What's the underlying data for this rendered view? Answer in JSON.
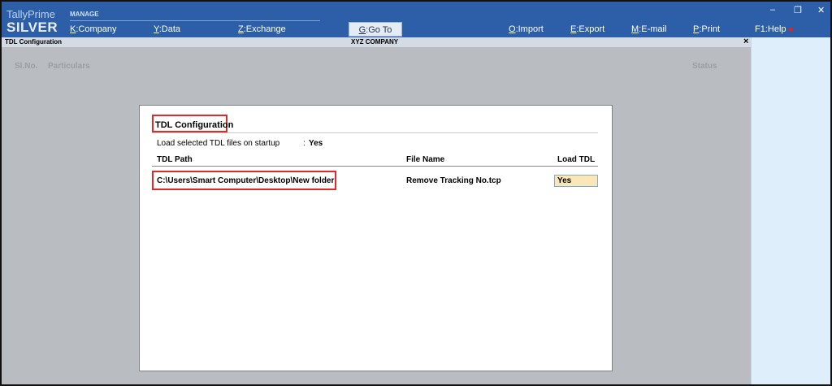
{
  "brand": {
    "line1": "TallyPrime",
    "line2": "SILVER"
  },
  "topbar": {
    "section_label": "MANAGE",
    "menu": [
      {
        "key": "K",
        "label": ":Company"
      },
      {
        "key": "Y",
        "label": ":Data"
      },
      {
        "key": "Z",
        "label": ":Exchange"
      }
    ],
    "goto": {
      "key": "G",
      "label": ":Go To"
    },
    "right_menu": [
      {
        "key": "O",
        "label": ":Import"
      },
      {
        "key": "E",
        "label": ":Export"
      },
      {
        "key": "M",
        "label": ":E-mail"
      },
      {
        "key": "P",
        "label": ":Print"
      },
      {
        "key": "F1",
        "label": ":Help"
      }
    ],
    "window_controls": {
      "minimize": "–",
      "restore": "❐",
      "close": "✕"
    }
  },
  "title_strip": {
    "screen_name": "TDL Configuration",
    "company": "XYZ COMPANY",
    "close": "×"
  },
  "background_table": {
    "headers": {
      "slno": "Sl.No.",
      "particulars": "Particulars",
      "status": "Status"
    }
  },
  "dialog": {
    "title": "TDL Configuration",
    "startup_label": "Load selected TDL files on startup",
    "startup_colon": ":",
    "startup_value": "Yes",
    "columns": {
      "path": "TDL Path",
      "file": "File Name",
      "load": "Load TDL"
    },
    "rows": [
      {
        "path": "C:\\Users\\Smart Computer\\Desktop\\New folder",
        "file": "Remove Tracking No.tcp",
        "load": "Yes"
      }
    ]
  },
  "colors": {
    "topbar": "#2c5fa8",
    "right_panel": "#deeefb",
    "highlight_border": "#e02a2a",
    "field_fill": "#fbe6b6"
  }
}
